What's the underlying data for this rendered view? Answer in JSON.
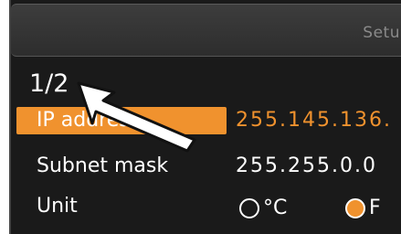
{
  "header": {
    "title": "Setu"
  },
  "page_indicator": "1/2",
  "rows": {
    "ip": {
      "label": "IP address",
      "value": "255.145.136."
    },
    "subnet": {
      "label": "Subnet mask",
      "value": "255.255.0.0"
    },
    "unit": {
      "label": "Unit",
      "options": [
        "°C",
        "F"
      ],
      "selected": "F"
    }
  },
  "colors": {
    "accent": "#f0922e",
    "background": "#1a1a1a",
    "text": "#ffffff",
    "header_text": "#8a8a8a"
  },
  "icons": {
    "cursor": "arrow-cursor-icon"
  }
}
